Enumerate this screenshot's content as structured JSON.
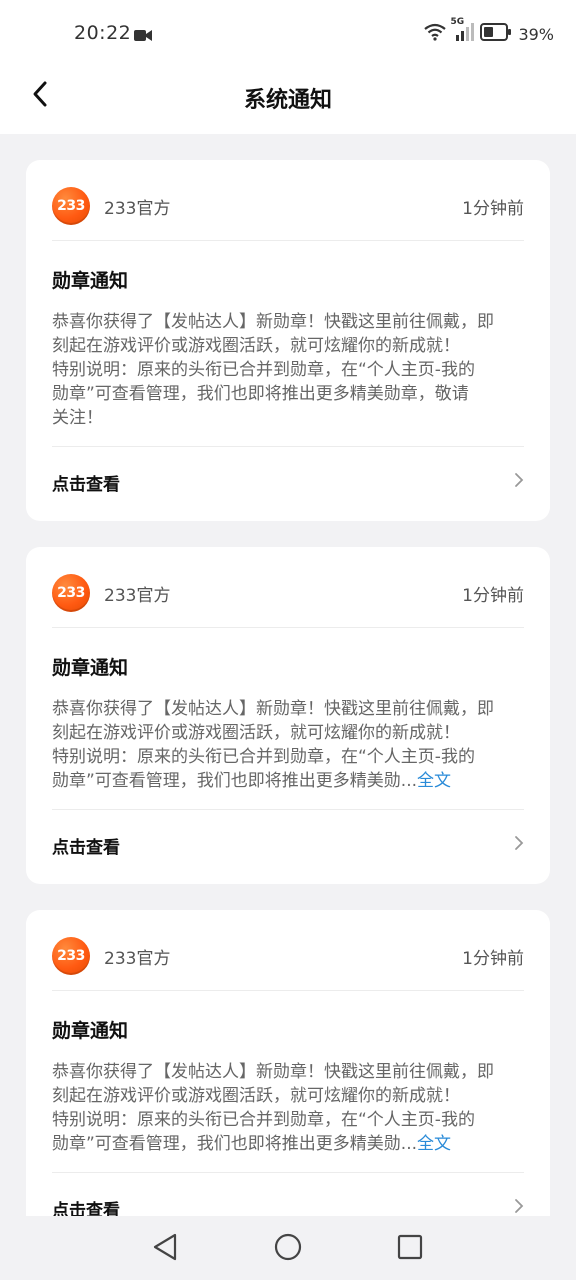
{
  "status_bar": {
    "time": "20:22",
    "network": "5G",
    "battery": "39%"
  },
  "header": {
    "title": "系统通知",
    "back_icon": "chevron-left-icon"
  },
  "notifications": [
    {
      "source": "233官方",
      "logo_text": "233",
      "time": "1分钟前",
      "title": "勋章通知",
      "lines": [
        "恭喜你获得了【发帖达人】新勋章！快戳这里前往佩戴，即",
        "刻起在游戏评价或游戏圈活跃，就可炫耀你的新成就！",
        "特别说明：原来的头衔已合并到勋章，在“个人主页-我的",
        "勋章”可查看管理，我们也即将推出更多精美勋章，敬请",
        "关注！"
      ],
      "action": "点击查看"
    },
    {
      "source": "233官方",
      "logo_text": "233",
      "time": "1分钟前",
      "title": "勋章通知",
      "lines": [
        "恭喜你获得了【发帖达人】新勋章！快戳这里前往佩戴，即",
        "刻起在游戏评价或游戏圈活跃，就可炫耀你的新成就！",
        "特别说明：原来的头衔已合并到勋章，在“个人主页-我的",
        "勋章”可查看管理，我们也即将推出更多精美勋..."
      ],
      "more_link": "全文",
      "action": "点击查看"
    },
    {
      "source": "233官方",
      "logo_text": "233",
      "time": "1分钟前",
      "title": "勋章通知",
      "lines": [
        "恭喜你获得了【发帖达人】新勋章！快戳这里前往佩戴，即",
        "刻起在游戏评价或游戏圈活跃，就可炫耀你的新成就！",
        "特别说明：原来的头衔已合并到勋章，在“个人主页-我的",
        "勋章”可查看管理，我们也即将推出更多精美勋..."
      ],
      "more_link": "全文",
      "action": "点击查看"
    }
  ],
  "nav_bar": {
    "back_icon": "triangle-back-icon",
    "home_icon": "circle-home-icon",
    "recents_icon": "square-recents-icon"
  }
}
